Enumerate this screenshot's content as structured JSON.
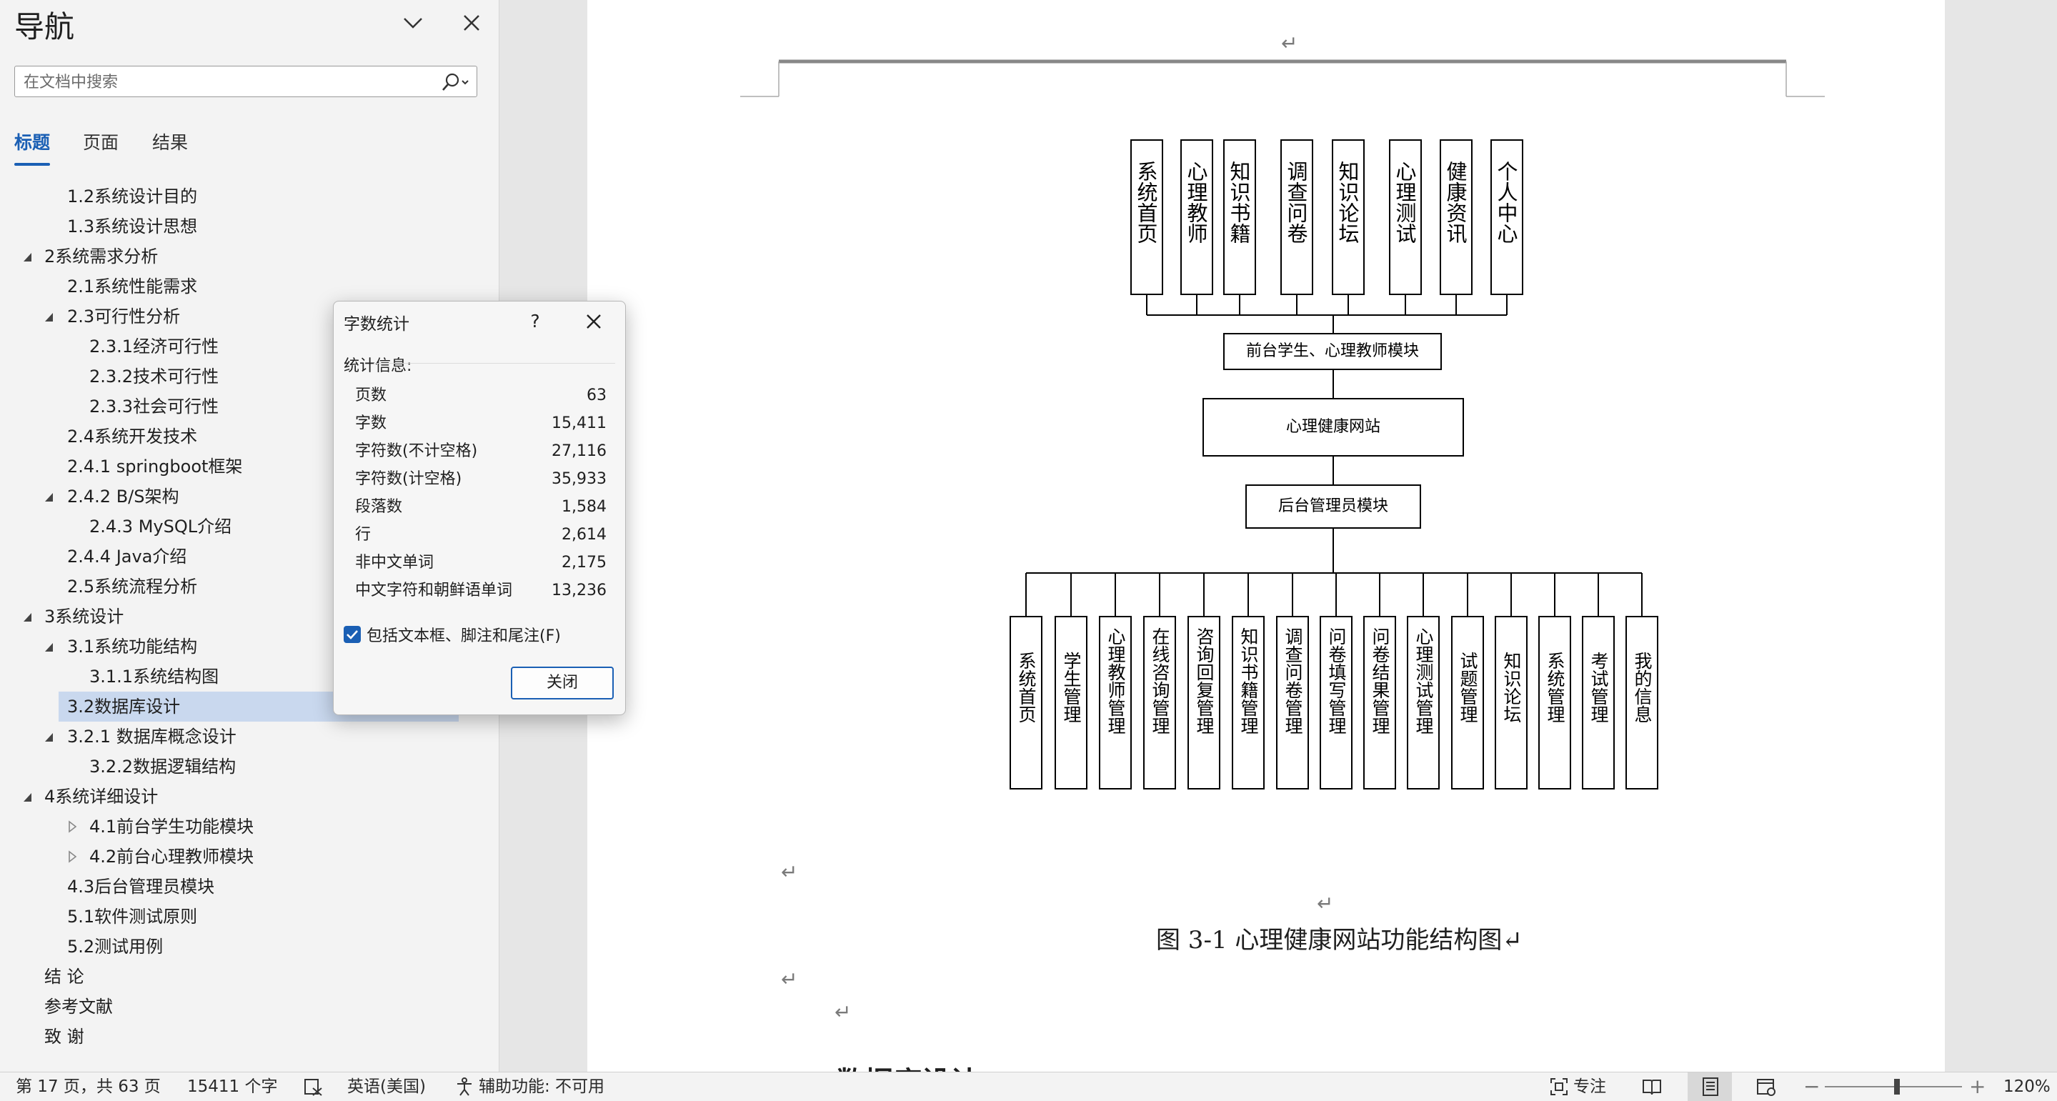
{
  "navigation": {
    "title": "导航",
    "search_placeholder": "在文档中搜索",
    "tabs": [
      {
        "label": "标题",
        "active": true
      },
      {
        "label": "页面",
        "active": false
      },
      {
        "label": "结果",
        "active": false
      }
    ],
    "tree": [
      {
        "label": "1.2系统设计目的",
        "level": 2,
        "caret": "none",
        "selected": false
      },
      {
        "label": "1.3系统设计思想",
        "level": 2,
        "caret": "none",
        "selected": false
      },
      {
        "label": "2系统需求分析",
        "level": 1,
        "caret": "expanded",
        "selected": false
      },
      {
        "label": "2.1系统性能需求",
        "level": 2,
        "caret": "none",
        "selected": false
      },
      {
        "label": "2.3可行性分析",
        "level": 2,
        "caret": "expanded",
        "selected": false
      },
      {
        "label": "2.3.1经济可行性",
        "level": 3,
        "caret": "none",
        "selected": false
      },
      {
        "label": "2.3.2技术可行性",
        "level": 3,
        "caret": "none",
        "selected": false
      },
      {
        "label": "2.3.3社会可行性",
        "level": 3,
        "caret": "none",
        "selected": false
      },
      {
        "label": "2.4系统开发技术",
        "level": 2,
        "caret": "none",
        "selected": false
      },
      {
        "label": "2.4.1 springboot框架",
        "level": 2,
        "caret": "none",
        "selected": false
      },
      {
        "label": "2.4.2 B/S架构",
        "level": 2,
        "caret": "expanded",
        "selected": false
      },
      {
        "label": "2.4.3 MySQL介绍",
        "level": 3,
        "caret": "none",
        "selected": false
      },
      {
        "label": "2.4.4 Java介绍",
        "level": 2,
        "caret": "none",
        "selected": false
      },
      {
        "label": "2.5系统流程分析",
        "level": 2,
        "caret": "none",
        "selected": false
      },
      {
        "label": "3系统设计",
        "level": 1,
        "caret": "expanded",
        "selected": false
      },
      {
        "label": "3.1系统功能结构",
        "level": 2,
        "caret": "expanded",
        "selected": false
      },
      {
        "label": "3.1.1系统结构图",
        "level": 3,
        "caret": "none",
        "selected": false
      },
      {
        "label": "3.2数据库设计",
        "level": 2,
        "caret": "none",
        "selected": true
      },
      {
        "label": "3.2.1 数据库概念设计",
        "level": 2,
        "caret": "expanded",
        "selected": false
      },
      {
        "label": "3.2.2数据逻辑结构",
        "level": 3,
        "caret": "none",
        "selected": false
      },
      {
        "label": "4系统详细设计",
        "level": 1,
        "caret": "expanded",
        "selected": false
      },
      {
        "label": "4.1前台学生功能模块",
        "level": 3,
        "caret": "collapsed",
        "selected": false
      },
      {
        "label": "4.2前台心理教师模块",
        "level": 3,
        "caret": "collapsed",
        "selected": false
      },
      {
        "label": "4.3后台管理员模块",
        "level": 2,
        "caret": "none",
        "selected": false
      },
      {
        "label": "5.1软件测试原则",
        "level": 2,
        "caret": "none",
        "selected": false
      },
      {
        "label": "5.2测试用例",
        "level": 2,
        "caret": "none",
        "selected": false
      },
      {
        "label": "结  论",
        "level": 1,
        "caret": "none",
        "selected": false
      },
      {
        "label": "参考文献",
        "level": 1,
        "caret": "none",
        "selected": false
      },
      {
        "label": "致  谢",
        "level": 1,
        "caret": "none",
        "selected": false
      }
    ]
  },
  "word_count_dialog": {
    "title": "字数统计",
    "help": "?",
    "section_label": "统计信息:",
    "rows": [
      {
        "label": "页数",
        "value": "63"
      },
      {
        "label": "字数",
        "value": "15,411"
      },
      {
        "label": "字符数(不计空格)",
        "value": "27,116"
      },
      {
        "label": "字符数(计空格)",
        "value": "35,933"
      },
      {
        "label": "段落数",
        "value": "1,584"
      },
      {
        "label": "行",
        "value": "2,614"
      },
      {
        "label": "非中文单词",
        "value": "2,175"
      },
      {
        "label": "中文字符和朝鲜语单词",
        "value": "13,236"
      }
    ],
    "include_checkbox": {
      "label": "包括文本框、脚注和尾注(F)",
      "checked": true
    },
    "close_button": "关闭"
  },
  "document": {
    "paragraph_mark": "↵",
    "figure_caption": "图 3-1  心理健康网站功能结构图↵",
    "next_heading_partial": "数据库设计",
    "diagram": {
      "top_modules": [
        "系统首页",
        "心理教师",
        "知识书籍",
        "调查问卷",
        "知识论坛",
        "心理测试",
        "健康资讯",
        "个人中心"
      ],
      "front_node": "前台学生、心理教师模块",
      "center_node": "心理健康网站",
      "back_node": "后台管理员模块",
      "bottom_modules": [
        "系统首页",
        "学生管理",
        "心理教师管理",
        "在线咨询管理",
        "咨询回复管理",
        "知识书籍管理",
        "调查问卷管理",
        "问卷填写管理",
        "问卷结果管理",
        "心理测试管理",
        "试题管理",
        "知识论坛",
        "系统管理",
        "考试管理",
        "我的信息"
      ]
    }
  },
  "status_bar": {
    "page": "第 17 页，共 63 页",
    "words": "15411 个字",
    "language": "英语(美国)",
    "accessibility": "辅助功能: 不可用",
    "focus": "专注",
    "zoom": "120%",
    "zoom_level_percent": 120
  },
  "colors": {
    "accent": "#1a5fb4",
    "selected_row": "#c9d8ee",
    "nav_background": "#f3f3f3",
    "workspace_background": "#e6e6e6"
  }
}
